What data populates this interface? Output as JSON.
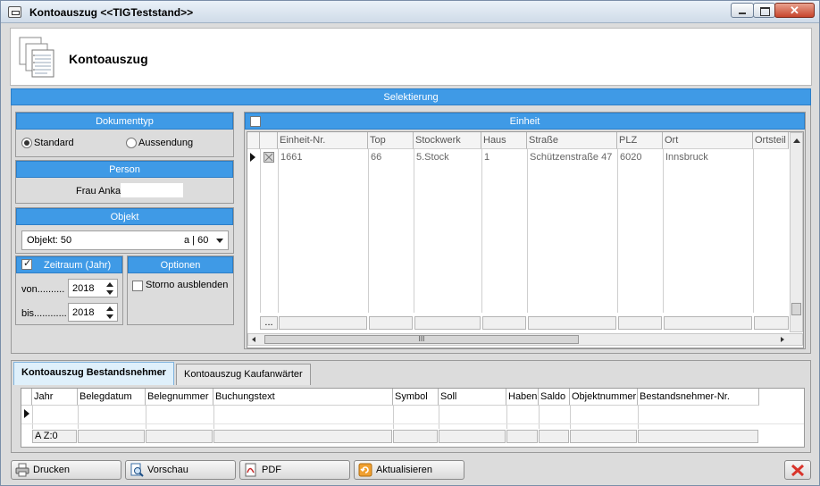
{
  "window": {
    "title": "Kontoauszug  <<TIGTeststand>>"
  },
  "header": {
    "title": "Kontoauszug"
  },
  "selection": {
    "title": "Selektierung"
  },
  "doctype": {
    "title": "Dokumenttyp",
    "options": [
      {
        "label": "Standard",
        "selected": true
      },
      {
        "label": "Aussendung",
        "selected": false
      }
    ]
  },
  "person": {
    "title": "Person",
    "value": "Frau Anka"
  },
  "objekt": {
    "title": "Objekt",
    "value_left": "Objekt: 50",
    "value_right": "a | 60"
  },
  "zeitraum": {
    "title": "Zeitraum (Jahr)",
    "checked": true,
    "von_label": "von..........",
    "von_value": "2018",
    "bis_label": "bis............",
    "bis_value": "2018"
  },
  "optionen": {
    "title": "Optionen",
    "storno_label": "Storno ausblenden",
    "storno_checked": false
  },
  "einheit": {
    "title": "Einheit",
    "columns": [
      "Einheit-Nr.",
      "Top",
      "Stockwerk",
      "Haus",
      "Straße",
      "PLZ",
      "Ort",
      "Ortsteil"
    ],
    "rows": [
      [
        "1661",
        "66",
        "5.Stock",
        "1",
        "Schützenstraße 47",
        "6020",
        "Innsbruck",
        ""
      ]
    ],
    "footer_button": "...",
    "scroll_grip": "III"
  },
  "tabs": [
    {
      "label": "Kontoauszug Bestandsnehmer",
      "active": true
    },
    {
      "label": "Kontoauszug Kaufanwärter",
      "active": false
    }
  ],
  "ledger": {
    "columns": [
      "Jahr",
      "Belegdatum",
      "Belegnummer",
      "Buchungstext",
      "Symbol",
      "Soll",
      "Haben",
      "Saldo",
      "Objektnummer",
      "Bestandsnehmer-Nr."
    ],
    "footer": "A Z:0"
  },
  "buttons": {
    "print": "Drucken",
    "preview": "Vorschau",
    "pdf": "PDF",
    "refresh": "Aktualisieren"
  },
  "colors": {
    "accent": "#3f9ae6",
    "close": "#d9342b"
  }
}
